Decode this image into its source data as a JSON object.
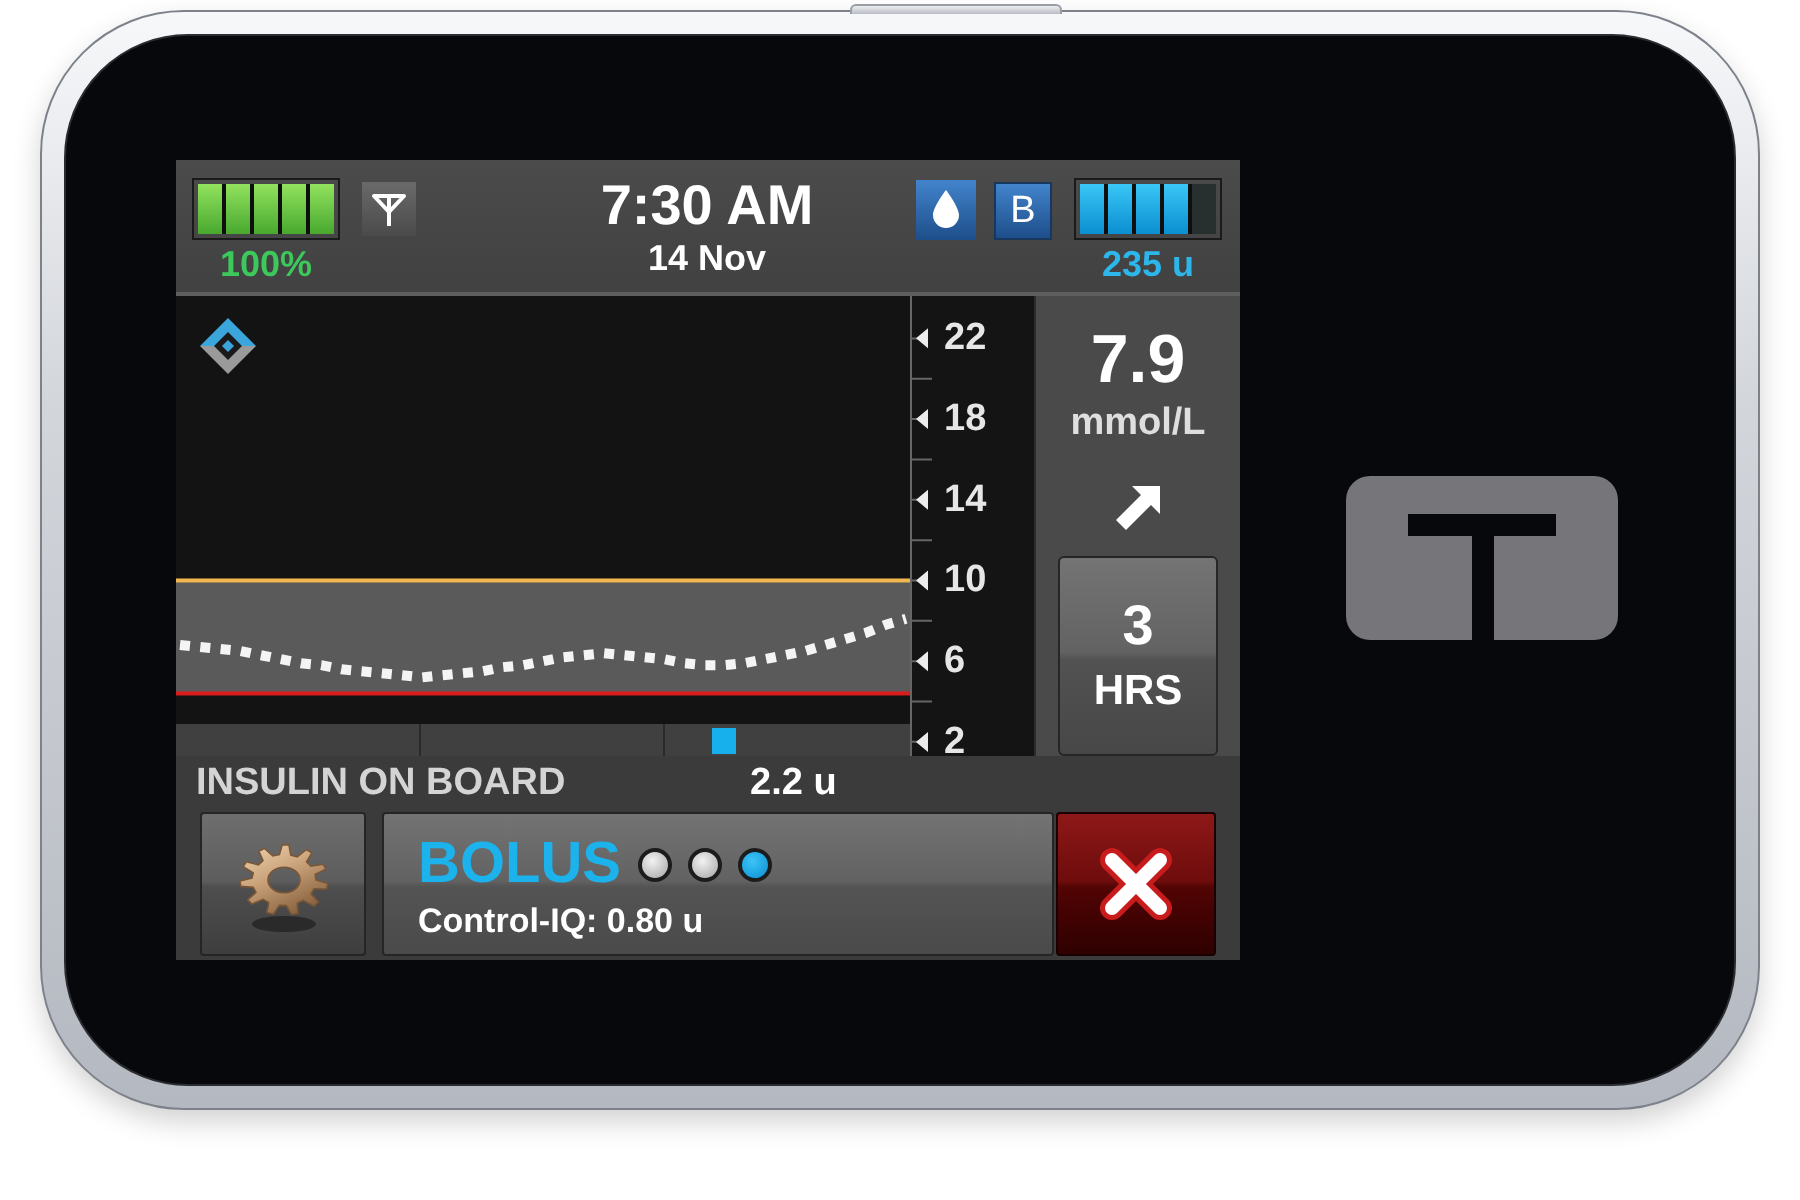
{
  "status_bar": {
    "battery": {
      "level": 1,
      "reading": "100%"
    },
    "time": "7:30 AM",
    "date": "14 Nov",
    "badge": "B",
    "insulin": {
      "level": 0.8,
      "reading": "235 u"
    }
  },
  "cgm": {
    "chart_data": {
      "type": "line",
      "line_style": "dotted",
      "ylim": [
        1.3,
        24.1
      ],
      "yticks": [
        2,
        6,
        10,
        14,
        18,
        22
      ],
      "values": [
        6.8,
        6.7,
        6.6,
        6.5,
        6.3,
        6.1,
        5.9,
        5.8,
        5.6,
        5.5,
        5.4,
        5.3,
        5.2,
        5.3,
        5.4,
        5.5,
        5.7,
        5.8,
        6.0,
        6.2,
        6.3,
        6.4,
        6.3,
        6.2,
        6.1,
        5.9,
        5.8,
        5.8,
        5.9,
        6.1,
        6.3,
        6.5,
        6.8,
        7.1,
        7.4,
        7.8,
        8.1
      ],
      "ref_lines": [
        {
          "axis": "y",
          "value": 10,
          "color": "#f0b650"
        },
        {
          "axis": "y",
          "value": 4.4,
          "color": "#dc1c1c"
        }
      ],
      "bands": [
        {
          "axis": "y",
          "from": 4.4,
          "to": 10,
          "color": "#5a5a5a"
        }
      ]
    },
    "reading": "7.9",
    "unit": "mmol/L",
    "time_span": {
      "value": "3",
      "unit": "HRS"
    }
  },
  "insulin_on_board": {
    "label": "INSULIN ON BOARD",
    "value": "2.2 u"
  },
  "bolus": {
    "title": "BOLUS",
    "progress": [
      {
        "active": false
      },
      {
        "active": false
      },
      {
        "active": true
      }
    ],
    "detail": "Control-IQ: 0.80 u"
  }
}
